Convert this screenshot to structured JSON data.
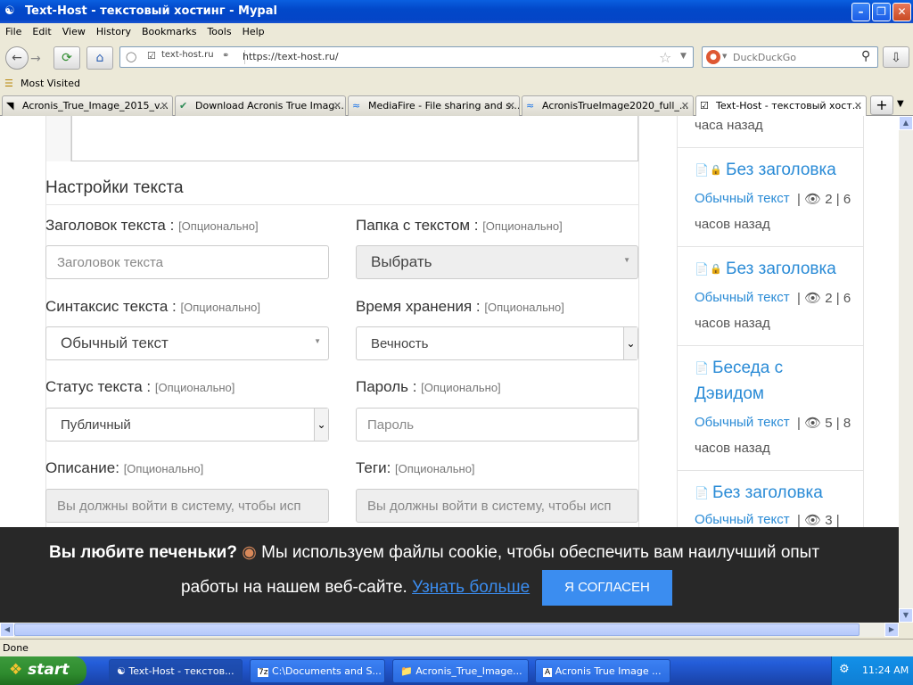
{
  "window": {
    "title": "Text-Host - текстовый хостинг - Mypal"
  },
  "menu": [
    "File",
    "Edit",
    "View",
    "History",
    "Bookmarks",
    "Tools",
    "Help"
  ],
  "address": {
    "site_label": "text-host.ru",
    "url": "https://text-host.ru/"
  },
  "search": {
    "placeholder": "DuckDuckGo"
  },
  "bookmarks": {
    "most_visited": "Most Visited"
  },
  "tabs": [
    {
      "label": "Acronis_True_Image_2015_v..."
    },
    {
      "label": "Download Acronis True Imag..."
    },
    {
      "label": "MediaFire - File sharing and s..."
    },
    {
      "label": "AcronisTrueImage2020_full_..."
    },
    {
      "label": "Text-Host - текстовый хост..."
    }
  ],
  "form": {
    "section_title": "Настройки текста",
    "optional": "[Опционально]",
    "title_label": "Заголовок текста :",
    "title_placeholder": "Заголовок текста",
    "folder_label": "Папка с текстом :",
    "folder_value": "Выбрать",
    "syntax_label": "Синтаксис текста :",
    "syntax_value": "Обычный текст",
    "expiry_label": "Время хранения :",
    "expiry_value": "Вечность",
    "status_label": "Статус текста :",
    "status_value": "Публичный",
    "password_label": "Пароль :",
    "password_placeholder": "Пароль",
    "description_label": "Описание:",
    "description_value": "Вы должны войти в систему, чтобы исп",
    "tags_label": "Теги:",
    "tags_value": "Вы должны войти в систему, чтобы исп"
  },
  "sidebar": {
    "top_time": "часа назад",
    "items": [
      {
        "title": "Без заголовка",
        "type": "Обычный текст",
        "views": "2",
        "time1": "6",
        "time2": "часов назад"
      },
      {
        "title": "Без заголовка",
        "type": "Обычный текст",
        "views": "2",
        "time1": "6",
        "time2": "часов назад"
      },
      {
        "title1": "Беседа с",
        "title2": "Дэвидом",
        "type": "Обычный текст",
        "views": "5",
        "time1": "8",
        "time2": "часов назад"
      },
      {
        "title": "Без заголовка",
        "type": "Обычный текст",
        "views": "3"
      }
    ]
  },
  "cookie": {
    "question": "Вы любите печеньки?",
    "text1": "Мы используем файлы cookie, чтобы обеспечить вам наилучший опыт",
    "text2": "работы на нашем веб-сайте.",
    "link": "Узнать больше",
    "button": "Я СОГЛАСЕН"
  },
  "status_bar": {
    "text": "Done"
  },
  "taskbar": {
    "start": "start",
    "tasks": [
      "Text-Host - текстов...",
      "C:\\Documents and S...",
      "Acronis_True_Image...",
      "Acronis True Image ..."
    ],
    "clock": "11:24 AM"
  },
  "colors": {
    "link": "#2a8bd6",
    "cookie_button": "#3b8df0",
    "lock": "#e03a5a"
  }
}
